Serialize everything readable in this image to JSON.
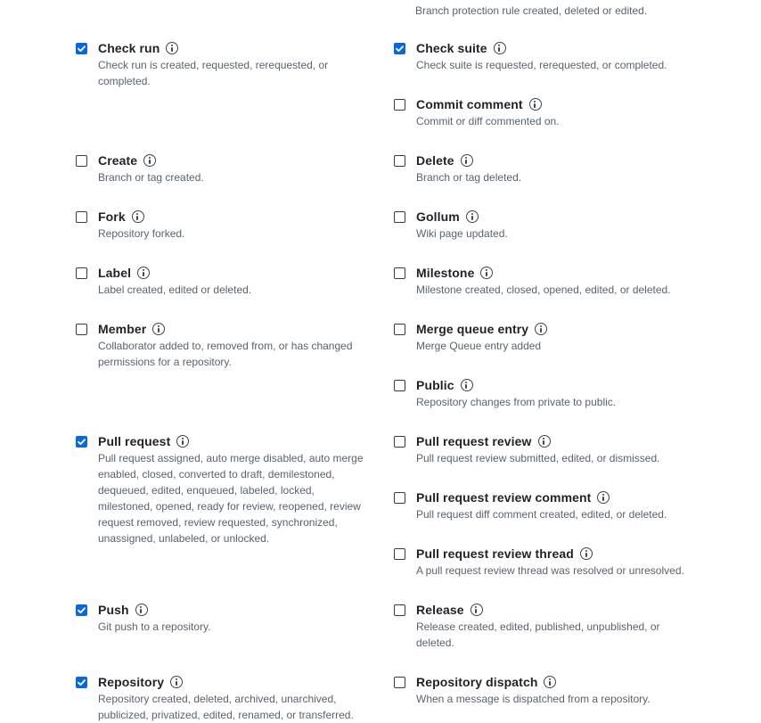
{
  "top_description": "Branch protection rule created, deleted or edited.",
  "events": [
    {
      "name": "Check run",
      "checked": true,
      "description": "Check run is created, requested, rerequested, or completed."
    },
    {
      "name": "Check suite",
      "checked": true,
      "description": "Check suite is requested, rerequested, or completed."
    },
    {
      "name": "Commit comment",
      "checked": false,
      "description": "Commit or diff commented on."
    },
    {
      "name": "Create",
      "checked": false,
      "description": "Branch or tag created."
    },
    {
      "name": "Delete",
      "checked": false,
      "description": "Branch or tag deleted."
    },
    {
      "name": "Fork",
      "checked": false,
      "description": "Repository forked."
    },
    {
      "name": "Gollum",
      "checked": false,
      "description": "Wiki page updated."
    },
    {
      "name": "Label",
      "checked": false,
      "description": "Label created, edited or deleted."
    },
    {
      "name": "Milestone",
      "checked": false,
      "description": "Milestone created, closed, opened, edited, or deleted."
    },
    {
      "name": "Member",
      "checked": false,
      "description": "Collaborator added to, removed from, or has changed permissions for a repository."
    },
    {
      "name": "Merge queue entry",
      "checked": false,
      "description": "Merge Queue entry added"
    },
    {
      "name": "Public",
      "checked": false,
      "description": "Repository changes from private to public."
    },
    {
      "name": "Pull request",
      "checked": true,
      "description": "Pull request assigned, auto merge disabled, auto merge enabled, closed, converted to draft, demilestoned, dequeued, edited, enqueued, labeled, locked, milestoned, opened, ready for review, reopened, review request removed, review requested, synchronized, unassigned, unlabeled, or unlocked."
    },
    {
      "name": "Pull request review",
      "checked": false,
      "description": "Pull request review submitted, edited, or dismissed."
    },
    {
      "name": "Pull request review comment",
      "checked": false,
      "description": "Pull request diff comment created, edited, or deleted."
    },
    {
      "name": "Pull request review thread",
      "checked": false,
      "description": "A pull request review thread was resolved or unresolved."
    },
    {
      "name": "Push",
      "checked": true,
      "description": "Git push to a repository."
    },
    {
      "name": "Release",
      "checked": false,
      "description": "Release created, edited, published, unpublished, or deleted."
    },
    {
      "name": "Repository",
      "checked": true,
      "description": "Repository created, deleted, archived, unarchived, publicized, privatized, edited, renamed, or transferred."
    },
    {
      "name": "Repository dispatch",
      "checked": false,
      "description": "When a message is dispatched from a repository."
    }
  ]
}
